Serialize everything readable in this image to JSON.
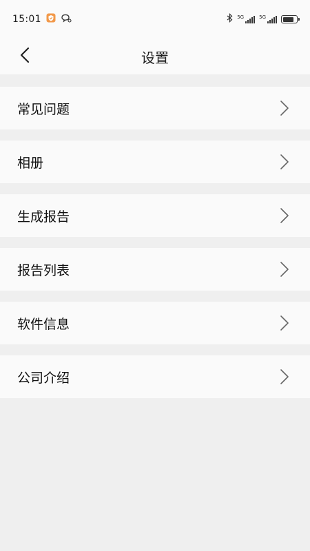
{
  "status_bar": {
    "time": "15:01",
    "icons": [
      "shield-app-icon",
      "chat-bubble-icon",
      "bluetooth-icon",
      "signal-5g-icon",
      "signal-5g-icon",
      "battery-icon"
    ],
    "signal1_label": "5G",
    "signal2_label": "5G",
    "battery_level": 0.8
  },
  "header": {
    "title": "设置",
    "back_icon": "chevron-left-icon"
  },
  "settings": {
    "items": [
      {
        "label": "常见问题",
        "icon": "chevron-right-icon"
      },
      {
        "label": "相册",
        "icon": "chevron-right-icon"
      },
      {
        "label": "生成报告",
        "icon": "chevron-right-icon"
      },
      {
        "label": "报告列表",
        "icon": "chevron-right-icon"
      },
      {
        "label": "软件信息",
        "icon": "chevron-right-icon"
      },
      {
        "label": "公司介绍",
        "icon": "chevron-right-icon"
      }
    ]
  },
  "colors": {
    "background": "#efefef",
    "surface": "#fafafa",
    "text": "#111111",
    "chevron": "#666666",
    "app_icon": "#f2994a"
  }
}
